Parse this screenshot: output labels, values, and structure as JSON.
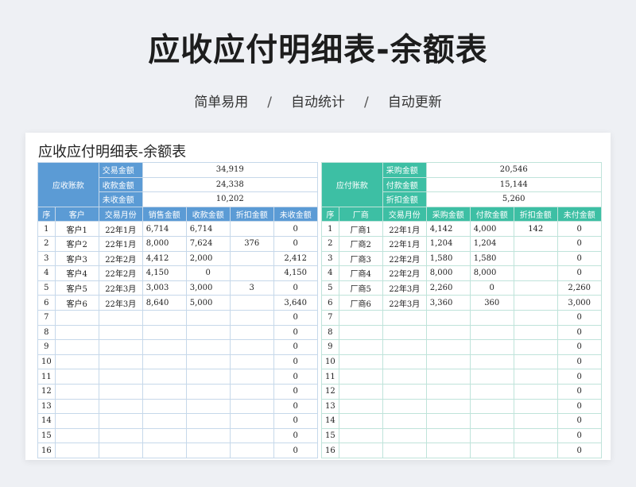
{
  "hero": {
    "title": "应收应付明细表-余额表",
    "tags": [
      "简单易用",
      "自动统计",
      "自动更新"
    ],
    "separator": "/"
  },
  "sheet": {
    "title": "应收应付明细表-余额表"
  },
  "receivable": {
    "group_label": "应收账款",
    "summary": [
      {
        "label": "交易金额",
        "value": "34,919"
      },
      {
        "label": "收款金额",
        "value": "24,338"
      },
      {
        "label": "未收金额",
        "value": "10,202"
      }
    ],
    "headers": [
      "序",
      "客户",
      "交易月份",
      "销售金额",
      "收款金额",
      "折扣金额",
      "未收金额"
    ],
    "rows": [
      [
        "1",
        "客户1",
        "22年1月",
        "6,714",
        "6,714",
        "",
        "0"
      ],
      [
        "2",
        "客户2",
        "22年1月",
        "8,000",
        "7,624",
        "376",
        "0"
      ],
      [
        "3",
        "客户3",
        "22年2月",
        "4,412",
        "2,000",
        "",
        "2,412"
      ],
      [
        "4",
        "客户4",
        "22年2月",
        "4,150",
        "0",
        "",
        "4,150"
      ],
      [
        "5",
        "客户5",
        "22年3月",
        "3,003",
        "3,000",
        "3",
        "0"
      ],
      [
        "6",
        "客户6",
        "22年3月",
        "8,640",
        "5,000",
        "",
        "3,640"
      ],
      [
        "7",
        "",
        "",
        "",
        "",
        "",
        "0"
      ],
      [
        "8",
        "",
        "",
        "",
        "",
        "",
        "0"
      ],
      [
        "9",
        "",
        "",
        "",
        "",
        "",
        "0"
      ],
      [
        "10",
        "",
        "",
        "",
        "",
        "",
        "0"
      ],
      [
        "11",
        "",
        "",
        "",
        "",
        "",
        "0"
      ],
      [
        "12",
        "",
        "",
        "",
        "",
        "",
        "0"
      ],
      [
        "13",
        "",
        "",
        "",
        "",
        "",
        "0"
      ],
      [
        "14",
        "",
        "",
        "",
        "",
        "",
        "0"
      ],
      [
        "15",
        "",
        "",
        "",
        "",
        "",
        "0"
      ],
      [
        "16",
        "",
        "",
        "",
        "",
        "",
        "0"
      ]
    ]
  },
  "payable": {
    "group_label": "应付账款",
    "summary": [
      {
        "label": "采购金额",
        "value": "20,546"
      },
      {
        "label": "付款金额",
        "value": "15,144"
      },
      {
        "label": "折扣金额",
        "value": "5,260"
      }
    ],
    "headers": [
      "序",
      "厂商",
      "交易月份",
      "采购金额",
      "付款金额",
      "折扣金额",
      "未付金额"
    ],
    "rows": [
      [
        "1",
        "厂商1",
        "22年1月",
        "4,142",
        "4,000",
        "142",
        "0"
      ],
      [
        "2",
        "厂商2",
        "22年1月",
        "1,204",
        "1,204",
        "",
        "0"
      ],
      [
        "3",
        "厂商3",
        "22年2月",
        "1,580",
        "1,580",
        "",
        "0"
      ],
      [
        "4",
        "厂商4",
        "22年2月",
        "8,000",
        "8,000",
        "",
        "0"
      ],
      [
        "5",
        "厂商5",
        "22年3月",
        "2,260",
        "0",
        "",
        "2,260"
      ],
      [
        "6",
        "厂商6",
        "22年3月",
        "3,360",
        "360",
        "",
        "3,000"
      ],
      [
        "7",
        "",
        "",
        "",
        "",
        "",
        "0"
      ],
      [
        "8",
        "",
        "",
        "",
        "",
        "",
        "0"
      ],
      [
        "9",
        "",
        "",
        "",
        "",
        "",
        "0"
      ],
      [
        "10",
        "",
        "",
        "",
        "",
        "",
        "0"
      ],
      [
        "11",
        "",
        "",
        "",
        "",
        "",
        "0"
      ],
      [
        "12",
        "",
        "",
        "",
        "",
        "",
        "0"
      ],
      [
        "13",
        "",
        "",
        "",
        "",
        "",
        "0"
      ],
      [
        "14",
        "",
        "",
        "",
        "",
        "",
        "0"
      ],
      [
        "15",
        "",
        "",
        "",
        "",
        "",
        "0"
      ],
      [
        "16",
        "",
        "",
        "",
        "",
        "",
        "0"
      ]
    ]
  }
}
